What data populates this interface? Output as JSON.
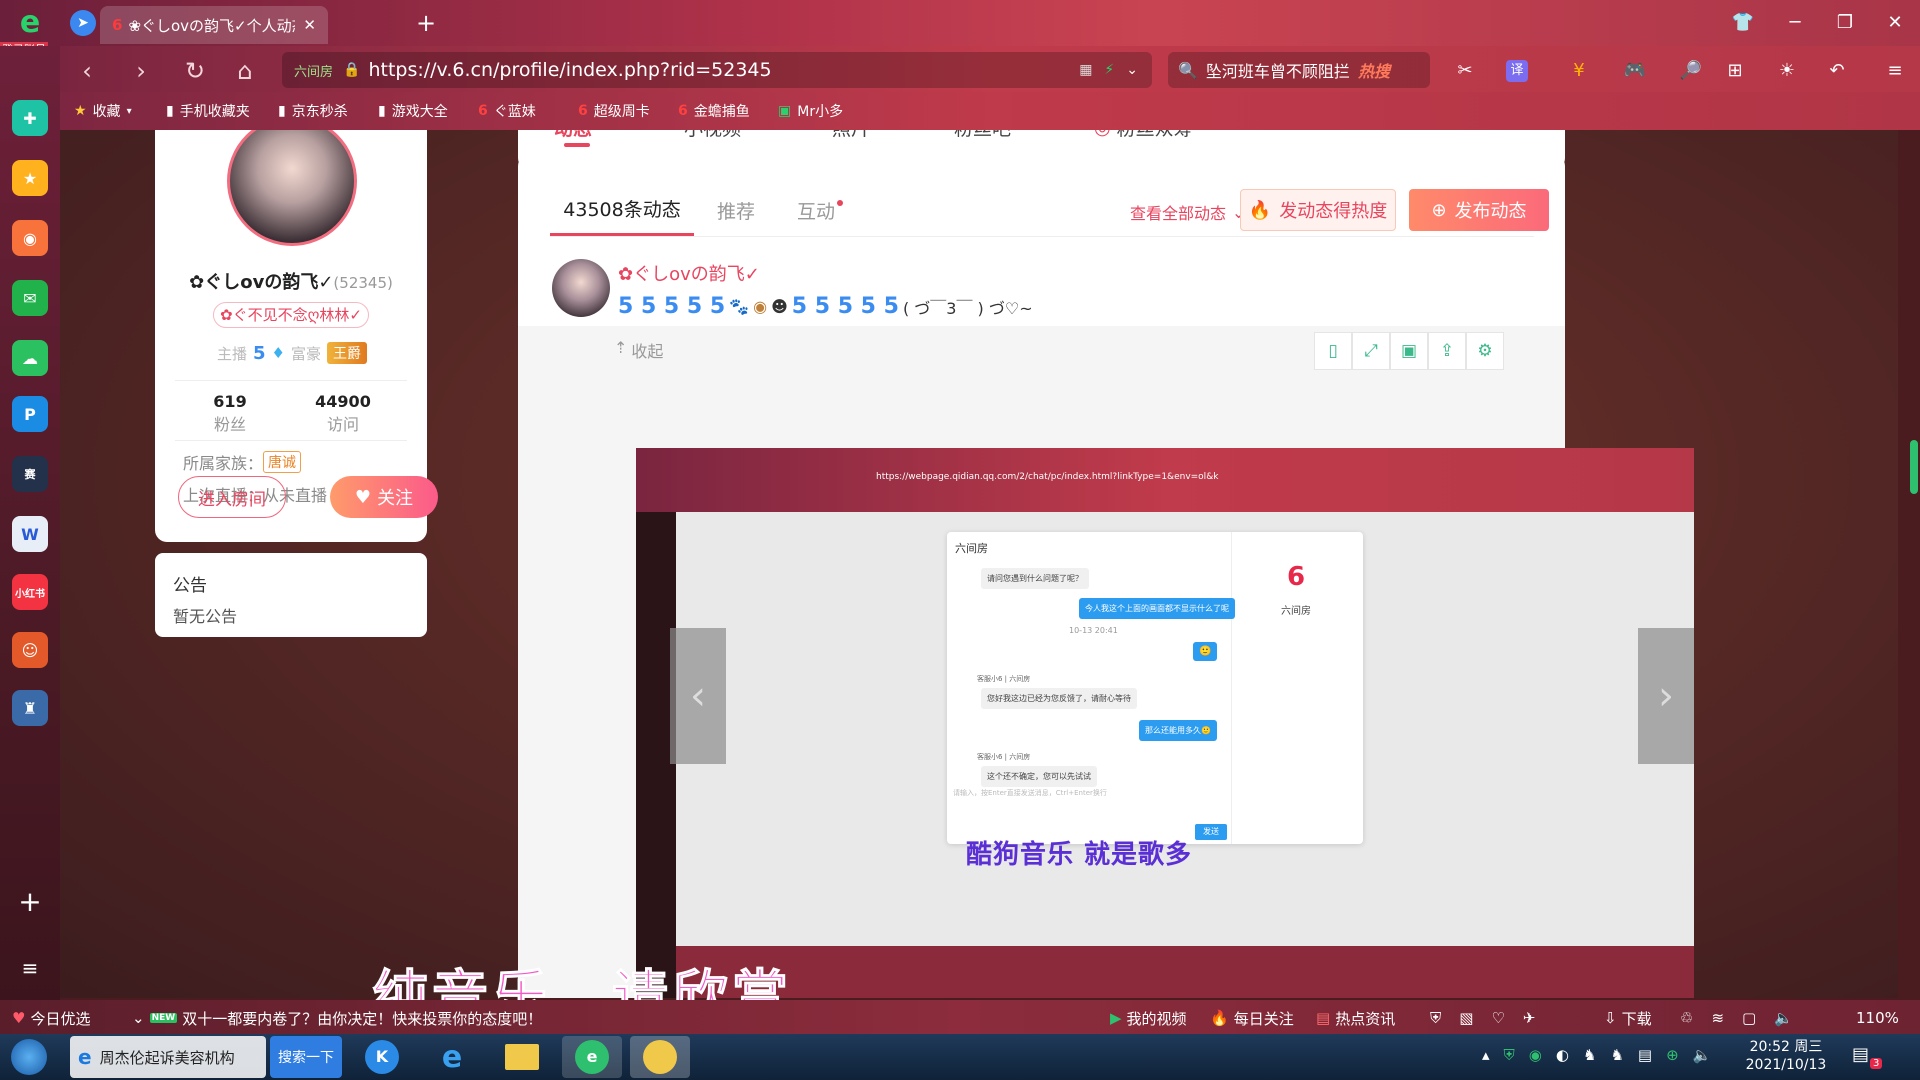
{
  "browser": {
    "login_label": "登录账号",
    "tab_title": "❀ぐしovの韵飞✓个人动态 - ❀",
    "new_tab_label": "+",
    "url_badge": "六间房",
    "url": "https://v.6.cn/profile/index.php?rid=52345",
    "search_text": "坠河班车曾不顾阻拦",
    "search_badge": "热搜",
    "bookmarks": [
      "收藏",
      "手机收藏夹",
      "京东秒杀",
      "游戏大全",
      "ぐ蓝妹",
      "超级周卡",
      "金蟾捕鱼",
      "Mr小多"
    ]
  },
  "profile_nav": {
    "tabs": [
      "动态",
      "小视频",
      "照片",
      "粉丝吧",
      "粉丝众筹"
    ]
  },
  "profile": {
    "name": "✿ぐしovの韵飞✓",
    "rid": "(52345)",
    "tag": "✿ぐ不见不念ღ林林✓",
    "anchor_label": "主播",
    "anchor_level": "5",
    "rich_label": "富豪",
    "rich_badge": "王爵",
    "fans_count": "619",
    "fans_label": "粉丝",
    "visits_count": "44900",
    "visits_label": "访问",
    "family_label": "所属家族：",
    "family_value": "唐诚",
    "last_live": "上次直播：从未直播",
    "enter_room": "进入房间",
    "follow": "关注"
  },
  "notice": {
    "title": "公告",
    "body": "暂无公告"
  },
  "feed": {
    "tabs": [
      "43508条动态",
      "推荐",
      "互动"
    ],
    "view_all": "查看全部动态",
    "hot_button": "发动态得热度",
    "publish_button": "发布动态",
    "post_author": "✿ぐしovの韵飞✓",
    "post_text": "( づ￣3￣ ) づ♡~",
    "collapse": "收起"
  },
  "embedded": {
    "url": "https://webpage.qidian.qq.com/2/chat/pc/index.html?linkType=1&env=ol&k",
    "chat_title": "六间房",
    "messages": [
      {
        "side": "left",
        "text": "请问您遇到什么问题了呢？"
      },
      {
        "side": "right",
        "text": "今人我这个上面的画面都不显示什么了呢"
      },
      {
        "side": "time",
        "text": "10-13 20:41"
      },
      {
        "side": "right",
        "text": "🙂"
      },
      {
        "side": "left",
        "name": "客服小6 | 六间房",
        "text": "您好我这边已经为您反馈了，请耐心等待"
      },
      {
        "side": "right",
        "text": "那么还能用多久🙂"
      },
      {
        "side": "left",
        "name": "客服小6 | 六间房",
        "text": "这个还不确定，您可以先试试"
      }
    ],
    "input_placeholder": "请输入，按Enter直接发送消息，Ctrl+Enter换行",
    "send": "发送",
    "brand": "六间房",
    "overlay": "酷狗音乐 就是歌多"
  },
  "subtitle": "纯音乐，请欣赏",
  "statusbar": {
    "left_label": "今日优选",
    "news_badge": "NEW",
    "news": "双十一都要内卷了？由你决定！快来投票你的态度吧！",
    "items": [
      "我的视频",
      "每日关注",
      "热点资讯"
    ],
    "download": "下载",
    "zoom": "110%"
  },
  "taskbar": {
    "ie_title": "周杰伦起诉美容机构",
    "search_btn": "搜索一下",
    "time": "20:52 周三",
    "date": "2021/10/13",
    "notif_count": "3"
  }
}
